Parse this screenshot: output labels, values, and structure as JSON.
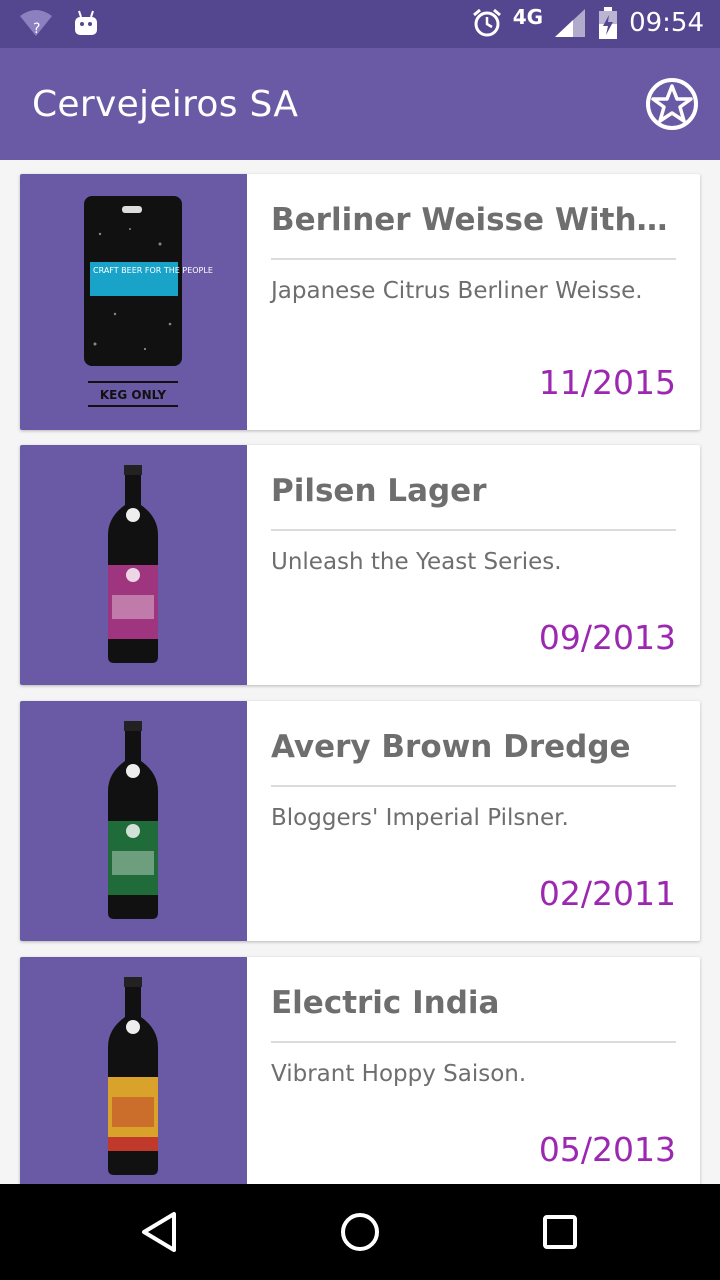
{
  "status_bar": {
    "time": "09:54",
    "network": "4G",
    "icons": [
      "wifi-question-icon",
      "android-icon",
      "alarm-icon",
      "signal-icon",
      "battery-charging-icon"
    ]
  },
  "app_bar": {
    "title": "Cervejeiros SA",
    "action_icon": "star-badge-icon"
  },
  "beers": [
    {
      "name": "Berliner Weisse With Y…",
      "tagline": "Japanese Citrus Berliner Weisse.",
      "date": "11/2015",
      "image": "keg-icon",
      "keg_text": "CRAFT BEER FOR THE PEOPLE",
      "keg_footer": "KEG ONLY"
    },
    {
      "name": "Pilsen Lager",
      "tagline": "Unleash the Yeast Series.",
      "date": "09/2013",
      "image": "bottle-icon",
      "label_color": "#a0357f"
    },
    {
      "name": "Avery Brown Dredge",
      "tagline": "Bloggers' Imperial Pilsner.",
      "date": "02/2011",
      "image": "bottle-icon",
      "label_color": "#1f6b3a"
    },
    {
      "name": "Electric India",
      "tagline": "Vibrant Hoppy Saison.",
      "date": "05/2013",
      "image": "bottle-icon",
      "label_color": "#d9a32b"
    }
  ],
  "colors": {
    "status_bar": "#54478f",
    "app_bar": "#6a5aa6",
    "date_accent": "#9c27b0"
  },
  "nav_bar": {
    "buttons": [
      "back-icon",
      "home-icon",
      "recents-icon"
    ]
  }
}
